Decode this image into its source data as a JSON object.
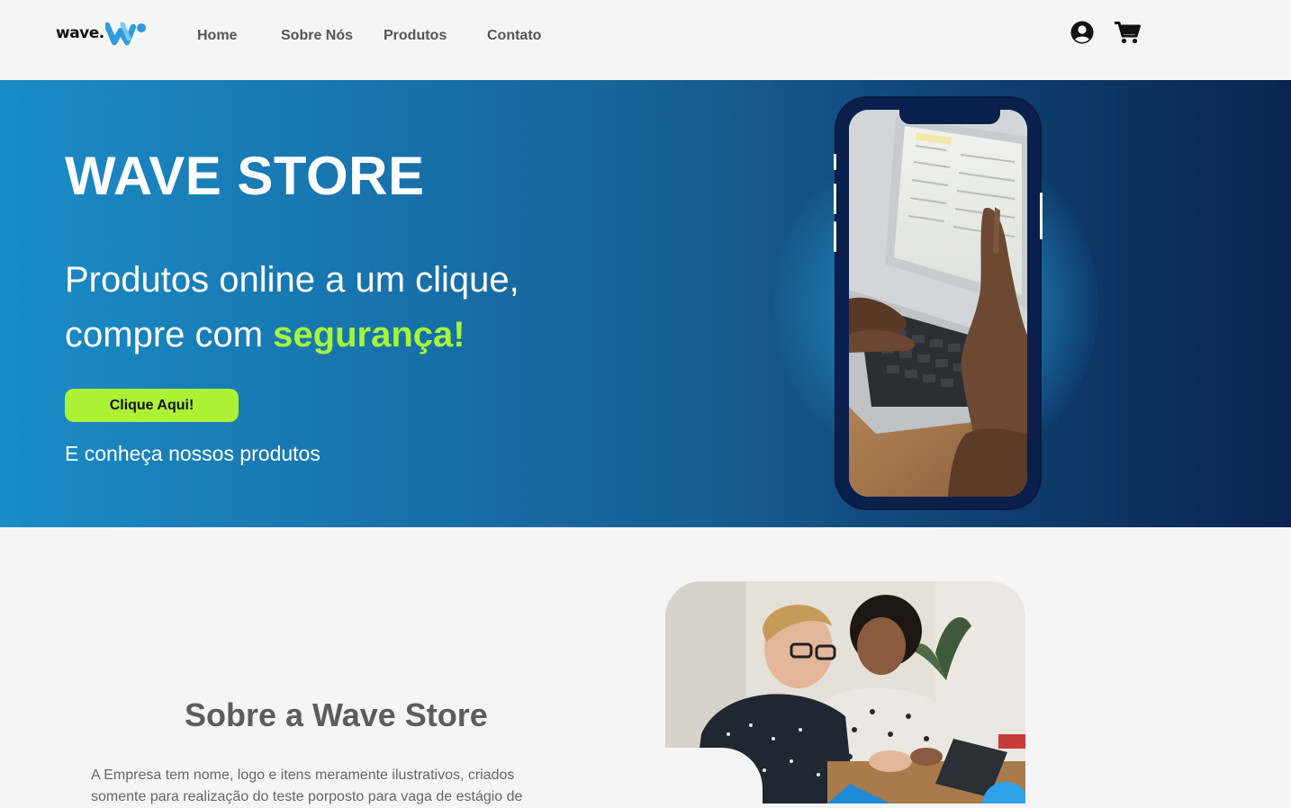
{
  "header": {
    "logo_text": "wave.",
    "nav": [
      {
        "label": "Home"
      },
      {
        "label": "Sobre Nós"
      },
      {
        "label": "Produtos"
      },
      {
        "label": "Contato"
      }
    ],
    "icons": [
      "user-icon",
      "cart-icon"
    ]
  },
  "hero": {
    "title": "WAVE STORE",
    "subtitle_line1": "Produtos online a um clique,",
    "subtitle_line2": "compre com ",
    "subtitle_accent": "segurança!",
    "cta_label": "Clique Aqui!",
    "caption": "E conheça nossos produtos"
  },
  "about": {
    "title": "Sobre a Wave Store",
    "text": "A Empresa tem nome, logo e itens meramente ilustrativos, criados somente para realização do teste porposto para vaga de estágio de"
  },
  "colors": {
    "accent": "#adf135",
    "accent_text": "#a6f53b",
    "hero_start": "#1a8cc6",
    "hero_end": "#0a2452",
    "logo_blue": "#2c9be0"
  }
}
